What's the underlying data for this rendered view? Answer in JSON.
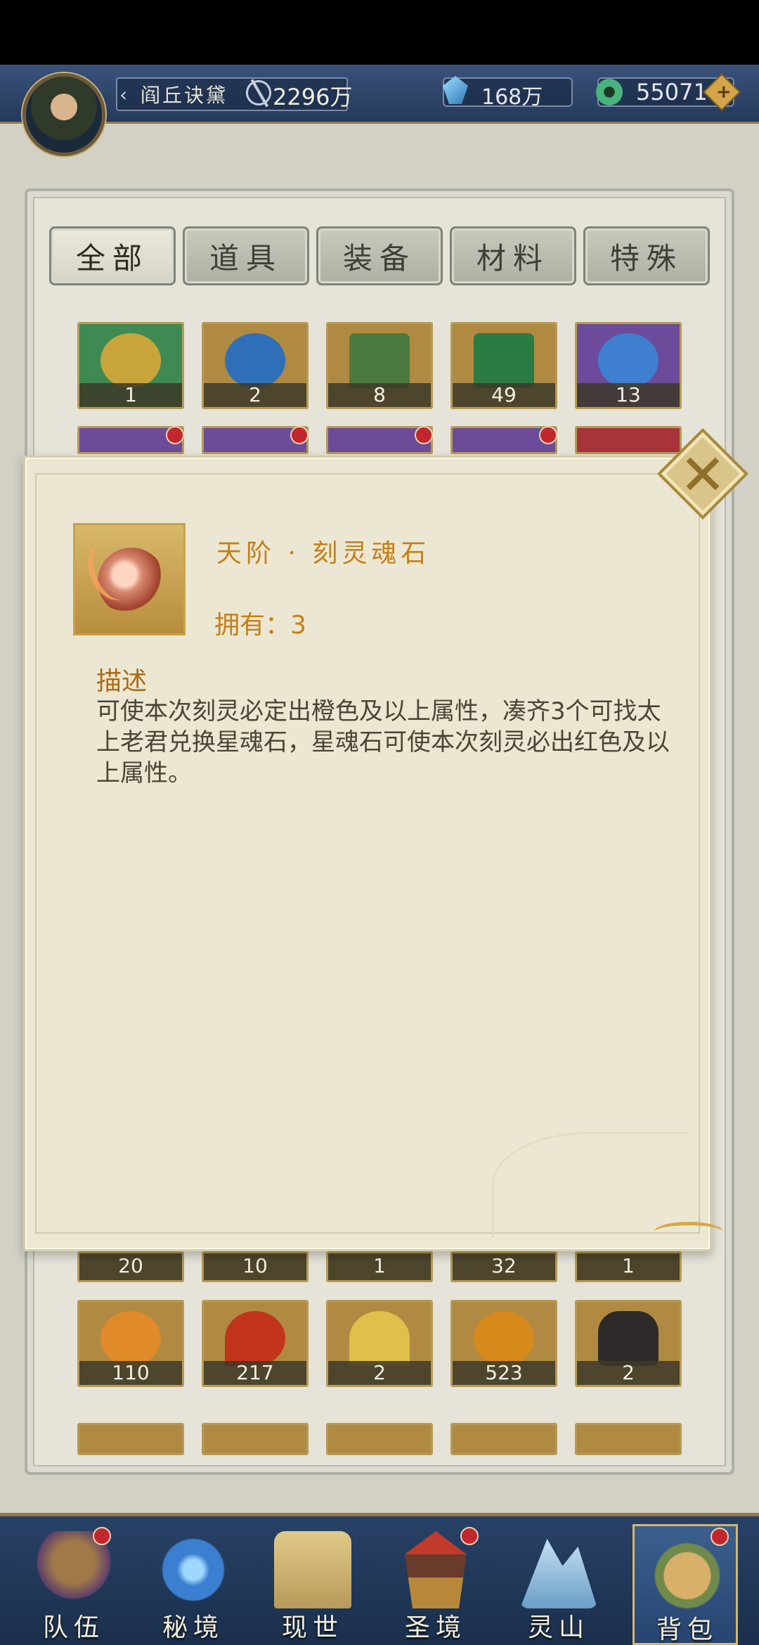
{
  "header": {
    "player_name": "阎丘诀黛",
    "power": "2296万",
    "crystal": "168万",
    "jade": "55071"
  },
  "tabs": [
    "全部",
    "道具",
    "装备",
    "材料",
    "特殊"
  ],
  "grid_row1": [
    {
      "count": "1",
      "color": "#3f8a52"
    },
    {
      "count": "2",
      "color": "#2f6fb8"
    },
    {
      "count": "8",
      "color": "#4c7a3e"
    },
    {
      "count": "49",
      "color": "#2c7a44"
    },
    {
      "count": "13",
      "color": "#6c4b9a"
    }
  ],
  "grid_row_hidden": [
    {
      "count": "20",
      "color": "#7a5a2e"
    },
    {
      "count": "10",
      "color": "#5a6a9a"
    },
    {
      "count": "1",
      "color": "#3a6f8a"
    },
    {
      "count": "32",
      "color": "#5a4a3a"
    },
    {
      "count": "1",
      "color": "#6a4a5a"
    }
  ],
  "grid_row3": [
    {
      "count": "110",
      "color": "#b46a1e"
    },
    {
      "count": "217",
      "color": "#c2351c"
    },
    {
      "count": "2",
      "color": "#c9a43a"
    },
    {
      "count": "523",
      "color": "#b8701c"
    },
    {
      "count": "2",
      "color": "#2e2a2a"
    }
  ],
  "detail": {
    "title": "天阶 · 刻灵魂石",
    "owned": "拥有：3",
    "desc_heading": "描述",
    "description": "可使本次刻灵必定出橙色及以上属性，凑齐3个可找太上老君兑换星魂石，星魂石可使本次刻灵必出红色及以上属性。"
  },
  "nav": [
    {
      "label": "队伍",
      "icon": "team-icon",
      "badge": true
    },
    {
      "label": "秘境",
      "icon": "portal-icon",
      "badge": false
    },
    {
      "label": "现世",
      "icon": "scroll-icon",
      "badge": false
    },
    {
      "label": "圣境",
      "icon": "palace-icon",
      "badge": true
    },
    {
      "label": "灵山",
      "icon": "mountain-icon",
      "badge": false
    },
    {
      "label": "背包",
      "icon": "bag-icon",
      "badge": true
    }
  ],
  "colors": {
    "accent_gold": "#c57f18",
    "badge_red": "#c2272d",
    "nav_bg": "#274166"
  }
}
